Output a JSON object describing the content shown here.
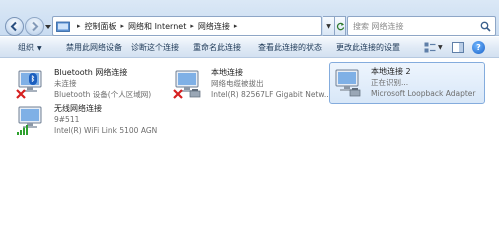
{
  "address_bar": {
    "breadcrumbs": [
      "控制面板",
      "网络和 Internet",
      "网络连接"
    ],
    "search_placeholder": "搜索 网络连接"
  },
  "command_bar": {
    "organize": "组织",
    "disable": "禁用此网络设备",
    "diagnose": "诊断这个连接",
    "rename": "重命名此连接",
    "view_status": "查看此连接的状态",
    "change_settings": "更改此连接的设置"
  },
  "connections": [
    {
      "name": "Bluetooth 网络连接",
      "status": "未连接",
      "device": "Bluetooth 设备(个人区域网)",
      "icon": "bluetooth-network-icon",
      "state": "disconnected"
    },
    {
      "name": "本地连接",
      "status": "网络电缆被拔出",
      "device": "Intel(R) 82567LF Gigabit Netw...",
      "icon": "ethernet-network-icon",
      "state": "cable-unplugged"
    },
    {
      "name": "本地连接 2",
      "status": "正在识别...",
      "device": "Microsoft Loopback Adapter",
      "icon": "loopback-network-icon",
      "state": "identifying",
      "selected": true
    },
    {
      "name": "无线网络连接",
      "status": "9#511",
      "device": "Intel(R) WiFi Link 5100 AGN",
      "icon": "wireless-network-icon",
      "state": "connected"
    }
  ],
  "colors": {
    "selected_bg": "#d8e7f8",
    "disconnected_x": "#d62020",
    "signal_green": "#2ea12e"
  }
}
